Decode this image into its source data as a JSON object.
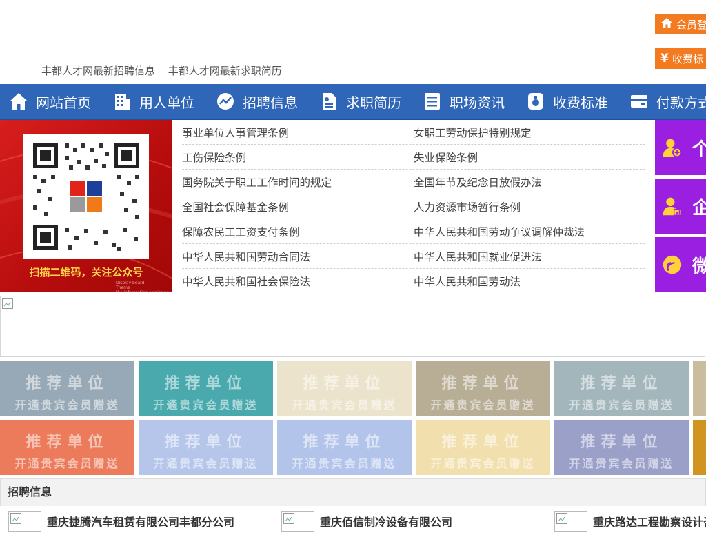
{
  "header": {
    "links": [
      "丰都人才网最新招聘信息",
      "丰都人才网最新求职简历"
    ],
    "member_login": "会员登",
    "fee_standard": "收费标"
  },
  "nav": [
    {
      "label": "网站首页",
      "icon": "home-icon"
    },
    {
      "label": "用人单位",
      "icon": "building-icon"
    },
    {
      "label": "招聘信息",
      "icon": "chart-icon"
    },
    {
      "label": "求职简历",
      "icon": "resume-icon"
    },
    {
      "label": "职场资讯",
      "icon": "news-icon"
    },
    {
      "label": "收费标准",
      "icon": "money-bag-icon"
    },
    {
      "label": "付款方式",
      "icon": "card-icon"
    }
  ],
  "qr": {
    "caption": "扫描二维码，关注公众号",
    "fine_print": "Display board\nTheme\nthe information carrier used to"
  },
  "laws": [
    [
      "事业单位人事管理条例",
      "女职工劳动保护特别规定"
    ],
    [
      "工伤保险条例",
      "失业保险条例"
    ],
    [
      "国务院关于职工工作时间的规定",
      "全国年节及纪念日放假办法"
    ],
    [
      "全国社会保障基金条例",
      "人力资源市场暂行条例"
    ],
    [
      "保障农民工工资支付条例",
      "中华人民共和国劳动争议调解仲裁法"
    ],
    [
      "中华人民共和国劳动合同法",
      "中华人民共和国就业促进法"
    ],
    [
      "中华人民共和国社会保险法",
      "中华人民共和国劳动法"
    ]
  ],
  "side_boxes": [
    {
      "label": "个",
      "icon": "person-add-icon"
    },
    {
      "label": "企",
      "icon": "business-person-icon"
    },
    {
      "label": "微",
      "icon": "wechat-icon"
    }
  ],
  "tiles": {
    "title": "推荐单位",
    "subtitle": "开通贵宾会员赠送",
    "row1_colors": [
      "#97a9b6",
      "#49a9ad",
      "#ece3cc",
      "#b8ad95",
      "#a3b6bc",
      "#c9bd9e"
    ],
    "row2_colors": [
      "#eb7b5b",
      "#b5c6ea",
      "#b3c4ea",
      "#f2dfae",
      "#9ba0c9",
      "#d19420"
    ]
  },
  "recruit": {
    "header": "招聘信息",
    "companies": [
      "重庆捷腾汽车租赁有限公司丰都分公司",
      "重庆佰信制冷设备有限公司",
      "重庆路达工程勘察设计咨询"
    ]
  }
}
